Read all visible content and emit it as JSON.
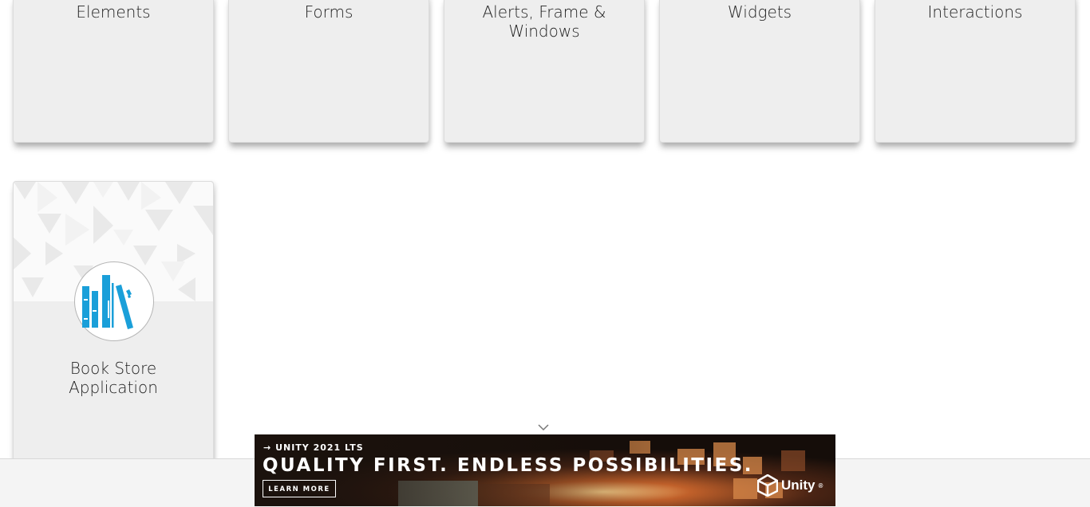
{
  "categories": [
    {
      "id": "elements",
      "label": "Elements"
    },
    {
      "id": "forms",
      "label": "Forms"
    },
    {
      "id": "alerts",
      "label": "Alerts, Frame & Windows"
    },
    {
      "id": "widgets",
      "label": "Widgets"
    },
    {
      "id": "interactions",
      "label": "Interactions"
    }
  ],
  "book_store": {
    "label": "Book Store Application",
    "icon": "books-icon",
    "icon_color": "#1a9fd9"
  },
  "ad": {
    "kicker": "UNITY 2021 LTS",
    "headline": "QUALITY FIRST. ENDLESS POSSIBILITIES.",
    "cta": "LEARN MORE",
    "brand": "Unity",
    "brand_mark": "®"
  },
  "icons": {
    "collapse": "chevron-down-icon",
    "arrow": "arrow-right-icon",
    "brand": "unity-logo-icon"
  }
}
